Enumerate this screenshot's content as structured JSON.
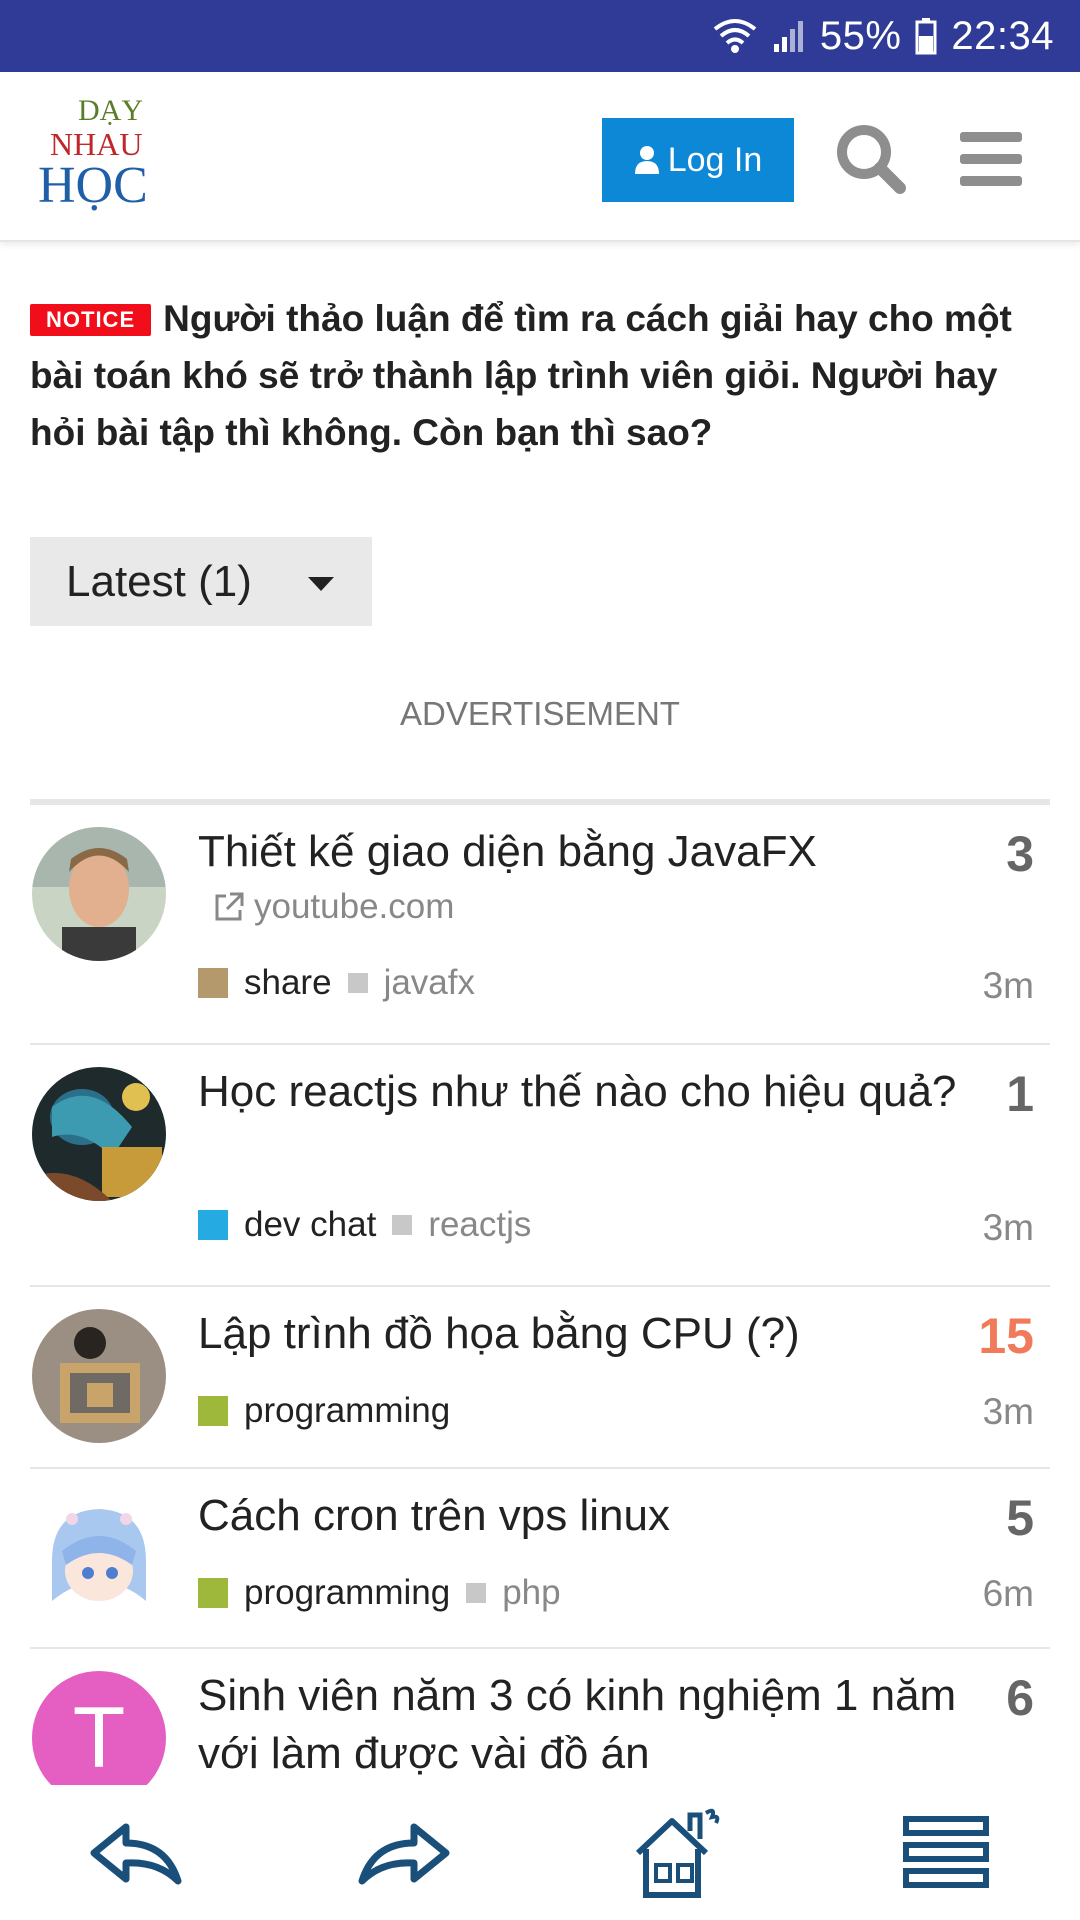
{
  "status_bar": {
    "battery": "55%",
    "time": "22:34"
  },
  "header": {
    "logo_line1": "DẠY",
    "logo_line2": "NHAU",
    "logo_line3": "HỌC",
    "login_label": "Log In"
  },
  "notice": {
    "badge": "NOTICE",
    "text": "Người thảo luận để tìm ra cách giải hay cho một bài toán khó sẽ trở thành lập trình viên giỏi. Người hay hỏi bài tập thì không. Còn bạn thì sao?"
  },
  "filter": {
    "label": "Latest (1)"
  },
  "ad_label": "ADVERTISEMENT",
  "topics": [
    {
      "title": "Thiết kế giao diện bằng JavaFX",
      "link": "youtube.com",
      "category": "share",
      "category_color": "#b3996b",
      "tag": "javafx",
      "count": "3",
      "age": "3m"
    },
    {
      "title": "Học reactjs như thế nào cho hiệu quả?",
      "category": "dev chat",
      "category_color": "#25aae2",
      "tag": "reactjs",
      "count": "1",
      "age": "3m"
    },
    {
      "title": "Lập trình đồ họa bằng CPU (?)",
      "category": "programming",
      "category_color": "#9eb83b",
      "count": "15",
      "count_color": "#f07a5a",
      "age": "3m"
    },
    {
      "title": "Cách cron trên vps linux",
      "category": "programming",
      "category_color": "#9eb83b",
      "tag": "php",
      "count": "5",
      "age": "6m"
    },
    {
      "title": "Sinh viên năm 3 có kinh nghiệm 1 năm với làm được vài đồ án",
      "avatar_letter": "T",
      "avatar_color": "#e45fc1",
      "count": "6"
    }
  ],
  "colors": {
    "status_bar": "#2f3b97",
    "login_button": "#0c88d6",
    "notice_badge": "#f20d1b",
    "nav_icon": "#1a4f7a"
  },
  "bottom_nav": [
    "back-icon",
    "forward-icon",
    "home-icon",
    "list-icon"
  ]
}
